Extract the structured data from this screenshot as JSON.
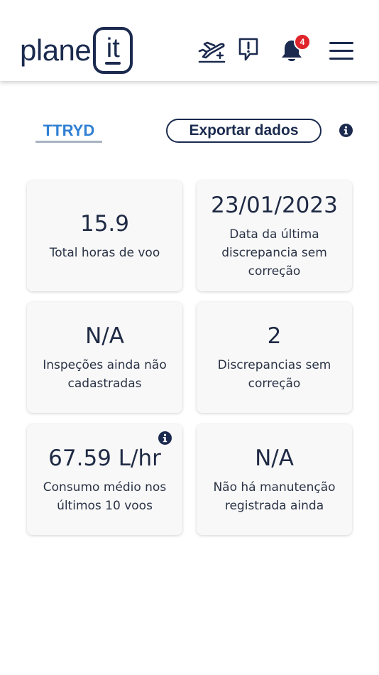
{
  "header": {
    "logo_text": "plane",
    "logo_box_text": "it",
    "notification_count": "4",
    "icons": [
      "plane-add-icon",
      "report-issue-icon",
      "bell-icon",
      "hamburger-menu-icon"
    ]
  },
  "toolbar": {
    "tab_label": "TTRYD",
    "export_label": "Exportar dados"
  },
  "cards": [
    {
      "value": "15.9",
      "label": "Total horas de voo"
    },
    {
      "value": "23/01/2023",
      "label": "Data da última discrepancia sem correção"
    },
    {
      "value": "N/A",
      "label": "Inspeções ainda não cadastradas"
    },
    {
      "value": "2",
      "label": "Discrepancias sem correção"
    },
    {
      "value": "67.59 L/hr",
      "label": "Consumo médio nos últimos 10 voos"
    },
    {
      "value": "N/A",
      "label": "Não há manutenção registrada ainda"
    }
  ],
  "colors": {
    "brand": "#1b2a4e",
    "tab_accent": "#2f7fd3",
    "badge": "#e0242b",
    "card_bg": "#f8f8f8"
  }
}
